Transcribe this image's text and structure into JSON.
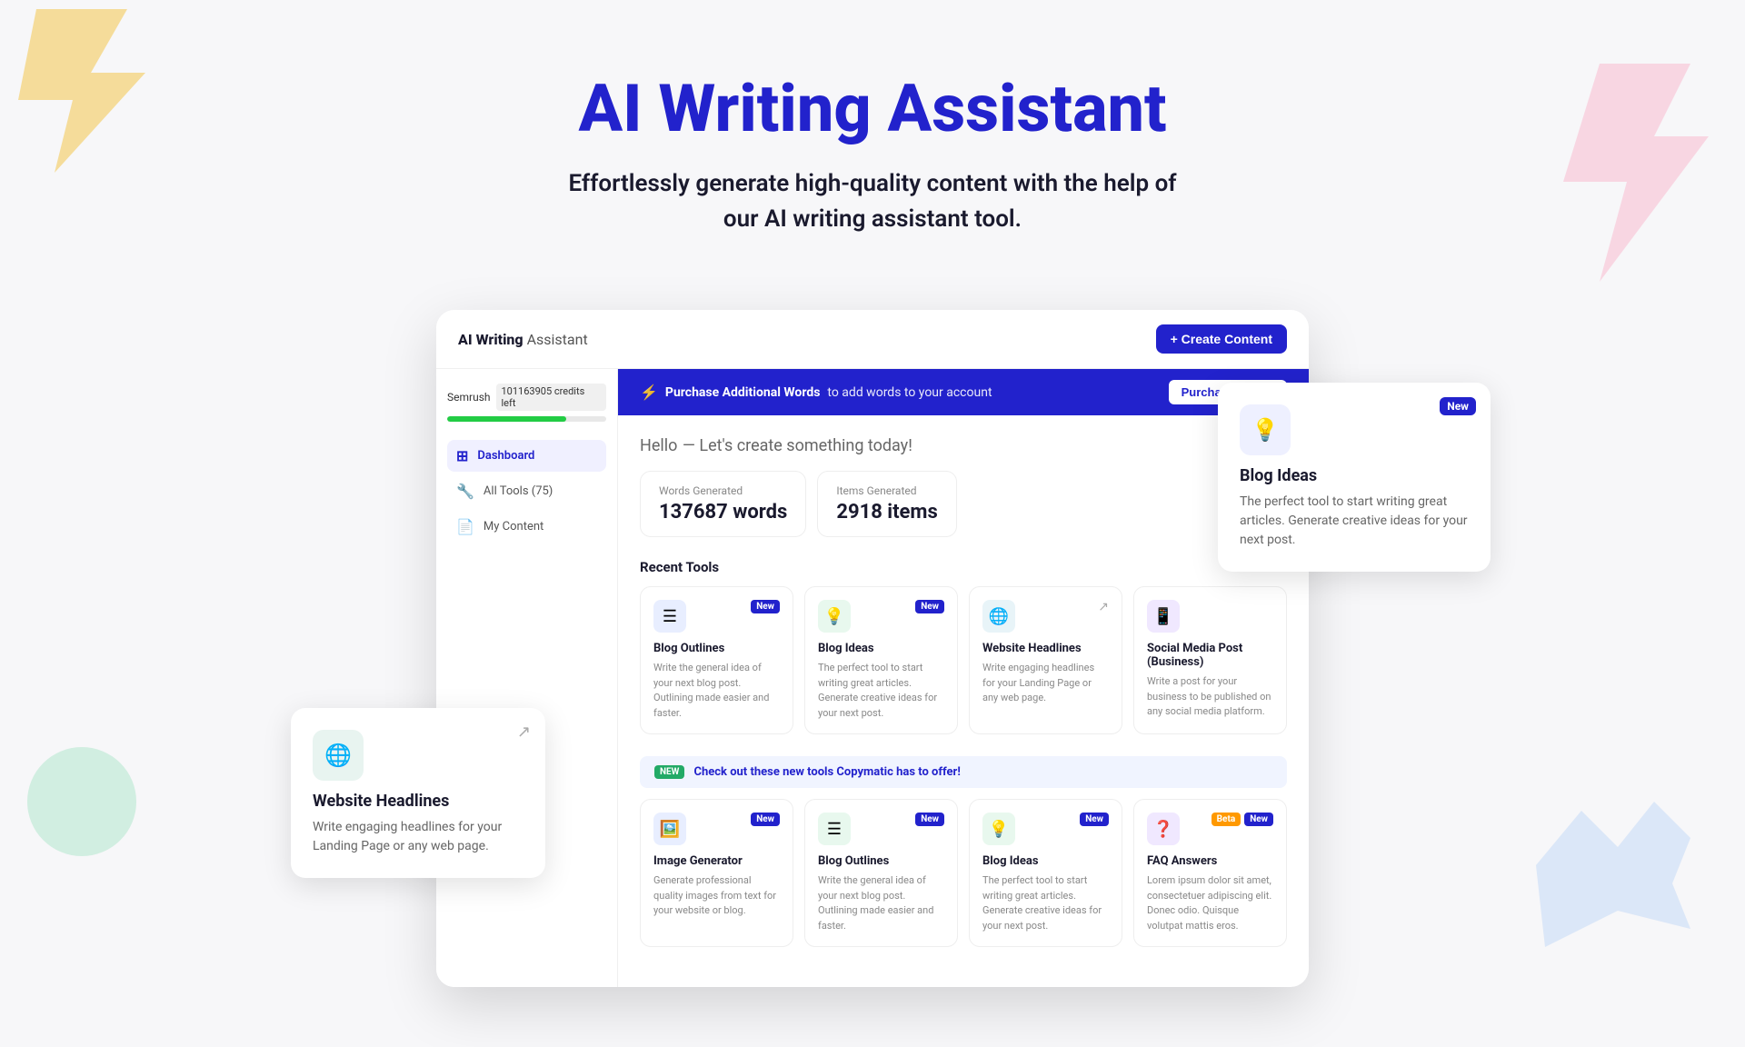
{
  "hero": {
    "title": "AI Writing Assistant",
    "subtitle": "Effortlessly generate high-quality content with the help of our AI writing assistant tool."
  },
  "floating_card_website": {
    "title": "Website Headlines",
    "description": "Write engaging headlines for your Landing Page or any web page.",
    "icon": "🌐"
  },
  "floating_card_blog": {
    "title": "Blog Ideas",
    "description": "The perfect tool to start writing great articles. Generate creative ideas for your next post.",
    "badge": "New",
    "icon": "💡"
  },
  "app": {
    "logo_bold": "AI Writing",
    "logo_light": " Assistant",
    "create_button": "+ Create Content",
    "credits": {
      "brand": "Semrush",
      "amount": "101163905",
      "label": "credits left"
    },
    "banner": {
      "icon": "⚡",
      "bold_text": "Purchase Additional Words",
      "light_text": "to add words to your account",
      "button": "Purchase Words"
    },
    "sidebar_items": [
      {
        "label": "Dashboard",
        "icon": "⊞",
        "active": true
      },
      {
        "label": "All Tools (75)",
        "icon": "🔧",
        "active": false
      },
      {
        "label": "My Content",
        "icon": "📄",
        "active": false
      }
    ],
    "dashboard": {
      "hello": "Hello",
      "tagline": "— Let's create something today!",
      "stats": [
        {
          "label": "Words Generated",
          "value": "137687 words"
        },
        {
          "label": "Items Generated",
          "value": "2918 items"
        }
      ],
      "recent_tools_title": "Recent Tools",
      "recent_tools": [
        {
          "name": "Blog Outlines",
          "description": "Write the general idea of your next blog post. Outlining made easier and faster.",
          "icon": "☰",
          "icon_bg": "blue",
          "badge": "New"
        },
        {
          "name": "Blog Ideas",
          "description": "The perfect tool to start writing great articles. Generate creative ideas for your next post.",
          "icon": "💡",
          "icon_bg": "green",
          "badge": "New"
        },
        {
          "name": "Website Headlines",
          "description": "Write engaging headlines for your Landing Page or any web page.",
          "icon": "🌐",
          "icon_bg": "teal",
          "badge": ""
        },
        {
          "name": "Social Media Post (Business)",
          "description": "Write a post for your business to be published on any social media platform.",
          "icon": "📱",
          "icon_bg": "purple",
          "badge": ""
        }
      ],
      "new_tools_banner": {
        "badge": "NEW",
        "text_bold": "Check out these new tools Copymatic has to offer!",
        "text_light": ""
      },
      "new_tools": [
        {
          "name": "Image Generator",
          "description": "Generate professional quality images from text for your website or blog.",
          "icon": "🖼️",
          "icon_bg": "blue",
          "badge": "New"
        },
        {
          "name": "Blog Outlines",
          "description": "Write the general idea of your next blog post. Outlining made easier and faster.",
          "icon": "☰",
          "icon_bg": "green",
          "badge": "New"
        },
        {
          "name": "Blog Ideas",
          "description": "The perfect tool to start writing great articles. Generate creative ideas for your next post.",
          "icon": "💡",
          "icon_bg": "green",
          "badge": "New"
        },
        {
          "name": "FAQ Answers",
          "description": "Lorem ipsum dolor sit amet, consectetuer adipiscing elit. Donec odio. Quisque volutpat mattis eros.",
          "icon": "❓",
          "icon_bg": "purple",
          "badge_beta": "Beta",
          "badge": "New"
        }
      ]
    }
  }
}
